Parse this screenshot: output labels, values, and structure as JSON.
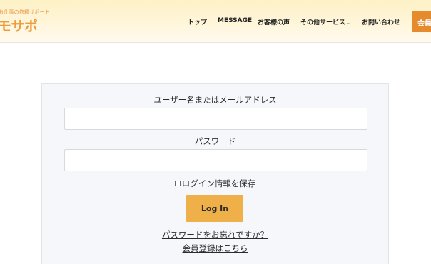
{
  "header": {
    "logo": {
      "tagline": "お仕事の依頼サポート",
      "name": "モサポ"
    },
    "nav": [
      {
        "label": "トップ"
      },
      {
        "label": "MESSAGE"
      },
      {
        "label": "お客様の声"
      },
      {
        "label": "その他サービス",
        "caret": "⌄"
      },
      {
        "label": "お問い合わせ"
      }
    ],
    "cta_label": "会員"
  },
  "login": {
    "username_label": "ユーザー名またはメールアドレス",
    "username_value": "",
    "password_label": "パスワード",
    "password_value": "",
    "remember_label": "ログイン情報を保存",
    "remember_checked": false,
    "submit_label": "Log In",
    "forgot_link": "パスワードをお忘れですか？",
    "register_link": "会員登録はこちら"
  },
  "colors": {
    "accent": "#e68a2e",
    "button": "#f0b049",
    "header_bg": "#fdf1c6",
    "form_bg": "#f6f7fb"
  }
}
